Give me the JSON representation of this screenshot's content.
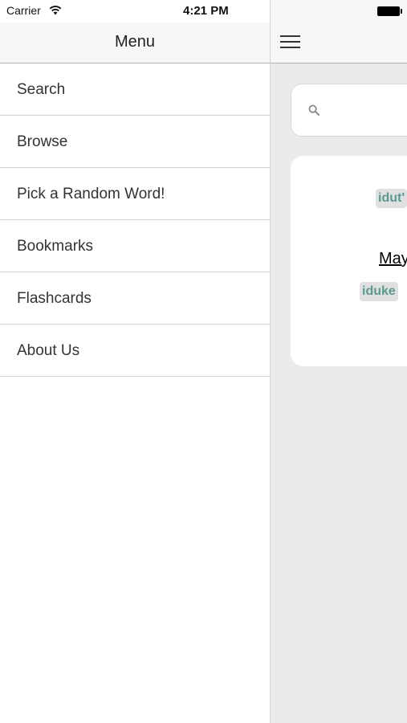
{
  "status_bar": {
    "carrier": "Carrier",
    "time": "4:21 PM"
  },
  "menu": {
    "title": "Menu",
    "items": [
      {
        "label": "Search"
      },
      {
        "label": "Browse"
      },
      {
        "label": "Pick a Random Word!"
      },
      {
        "label": "Bookmarks"
      },
      {
        "label": "Flashcards"
      },
      {
        "label": "About Us"
      }
    ]
  },
  "content": {
    "search": {
      "value": "",
      "placeholder": ""
    },
    "card": {
      "tag_top": "idut'",
      "word": "May",
      "tag_bottom": "iduke"
    }
  },
  "icons": {
    "wifi": "wifi-icon",
    "battery": "battery-icon",
    "menu": "hamburger-icon",
    "search": "search-icon"
  },
  "colors": {
    "header_bg": "#f7f7f7",
    "content_bg": "#ebebeb",
    "tag_text": "#5a9a92",
    "tag_bg": "#e0e0e0"
  }
}
